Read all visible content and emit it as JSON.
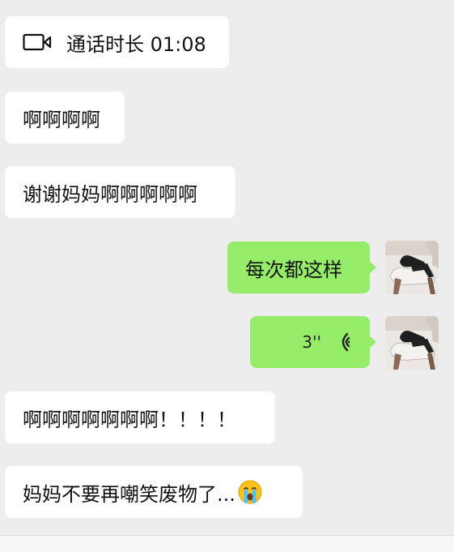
{
  "messages": {
    "call": {
      "label": "通话时长 01:08",
      "icon": "video-camera-icon"
    },
    "m1": {
      "text": "啊啊啊啊"
    },
    "m2": {
      "text": "谢谢妈妈啊啊啊啊啊"
    },
    "m3": {
      "text": "每次都这样"
    },
    "voice": {
      "duration": "3''",
      "icon": "voice-wave-icon"
    },
    "m4": {
      "text": "啊啊啊啊啊啊啊！！！！"
    },
    "m5": {
      "text": "妈妈不要再嘲笑废物了...",
      "emoji": "crying-face-icon"
    }
  },
  "colors": {
    "background": "#ededed",
    "outgoing_bubble": "#95ec69",
    "incoming_bubble": "#ffffff"
  }
}
